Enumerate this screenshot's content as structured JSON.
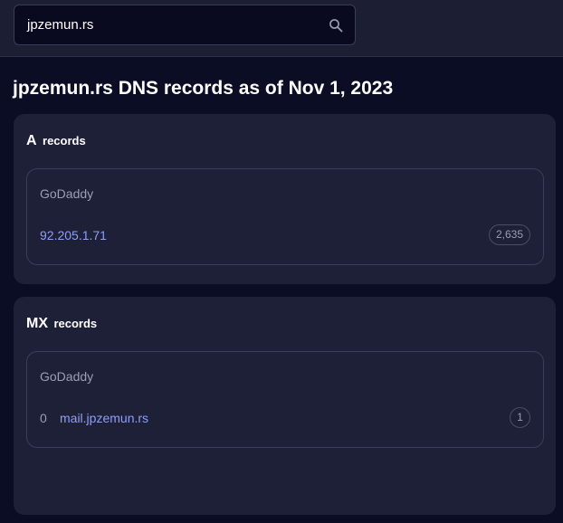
{
  "search": {
    "value": "jpzemun.rs"
  },
  "page": {
    "title": "jpzemun.rs DNS records as of Nov 1, 2023"
  },
  "a_records": {
    "type": "A",
    "suffix": "records",
    "provider": "GoDaddy",
    "records": [
      {
        "value": "92.205.1.71",
        "count": "2,635"
      }
    ]
  },
  "mx_records": {
    "type": "MX",
    "suffix": "records",
    "provider": "GoDaddy",
    "records": [
      {
        "priority": "0",
        "value": "mail.jpzemun.rs",
        "count": "1"
      }
    ]
  },
  "colors": {
    "background": "#0b0d24",
    "topbar": "#1c1e33",
    "card": "#1e2038",
    "link": "#8f9ef5",
    "muted": "#9b9db5"
  }
}
